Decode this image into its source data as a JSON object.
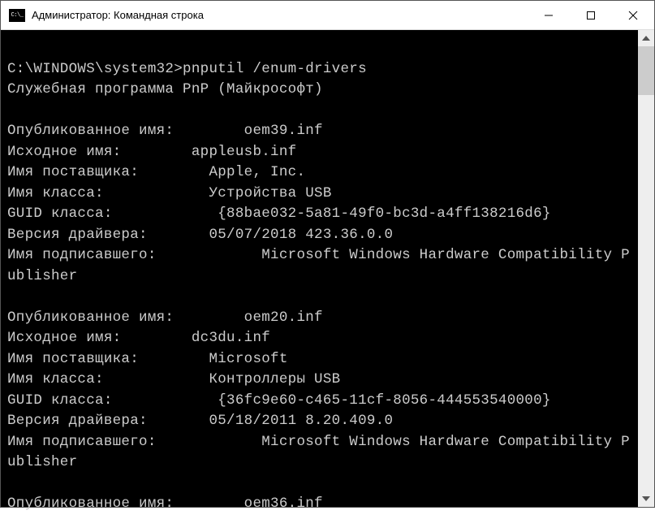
{
  "window": {
    "title": "Администратор: Командная строка"
  },
  "prompt": "C:\\WINDOWS\\system32>",
  "command": "pnputil /enum-drivers",
  "header_line": "Служебная программа PnP (Майкрософт)",
  "labels": {
    "published_name": "Опубликованное имя:",
    "original_name": "Исходное имя:",
    "provider_name": "Имя поставщика:",
    "class_name": "Имя класса:",
    "class_guid": "GUID класса:",
    "driver_version": "Версия драйвера:",
    "signer_name": "Имя подписавшего:"
  },
  "drivers": [
    {
      "published": "oem39.inf",
      "original": "appleusb.inf",
      "provider": "Apple, Inc.",
      "class": "Устройства USB",
      "guid": "{88bae032-5a81-49f0-bc3d-a4ff138216d6}",
      "version": "05/07/2018 423.36.0.0",
      "signer": "Microsoft Windows Hardware Compatibility Publisher"
    },
    {
      "published": "oem20.inf",
      "original": "dc3du.inf",
      "provider": "Microsoft",
      "class": "Контроллеры USB",
      "guid": "{36fc9e60-c465-11cf-8056-444553540000}",
      "version": "05/18/2011 8.20.409.0",
      "signer": "Microsoft Windows Hardware Compatibility Publisher"
    },
    {
      "published": "oem36.inf"
    }
  ]
}
